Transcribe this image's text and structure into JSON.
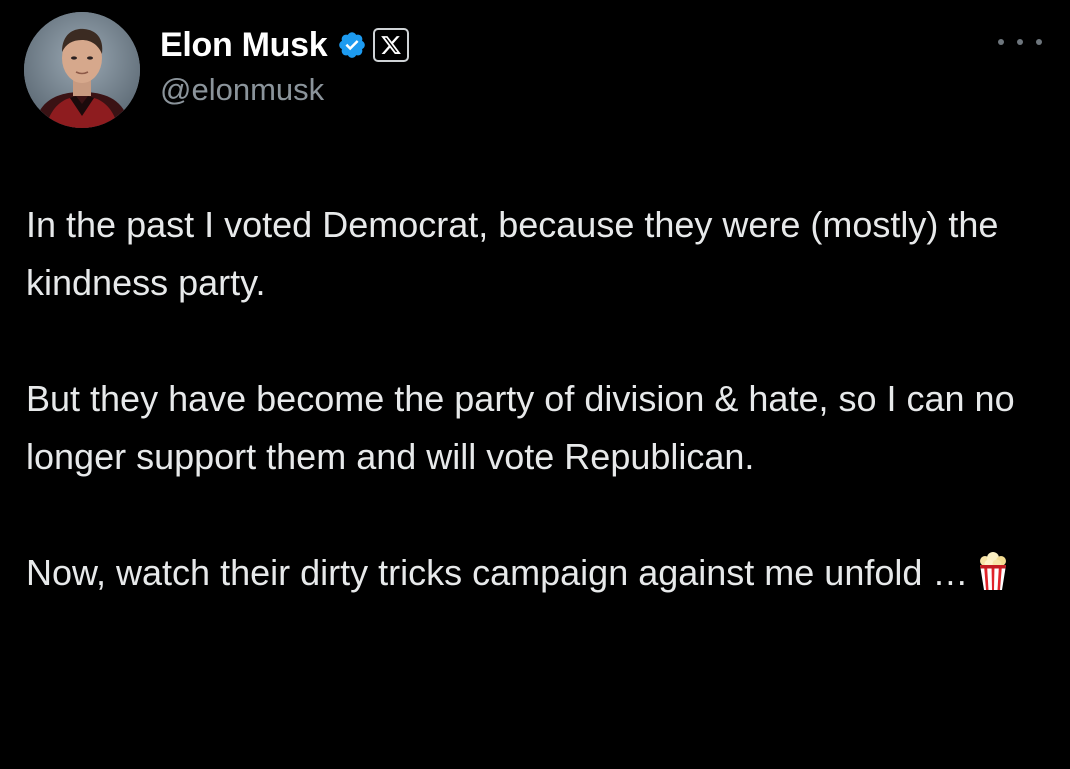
{
  "author": {
    "display_name": "Elon Musk",
    "handle": "@elonmusk",
    "verified": true,
    "badge_color": "#1d9bf0",
    "affiliate_icon": "x-logo-icon",
    "avatar_icon": "profile-photo"
  },
  "menu": {
    "icon": "more-options-icon"
  },
  "tweet": {
    "paragraphs": [
      "In the past I voted Democrat, because they were (mostly) the kindness party.",
      "But they have become the party of division & hate, so I can no longer support them and will vote Republican.",
      "Now, watch their dirty tricks campaign against me unfold …"
    ],
    "trailing_emoji": "popcorn-icon"
  },
  "colors": {
    "background": "#000000",
    "text": "#e7e9ea",
    "secondary_text": "#8b949b",
    "accent": "#1d9bf0"
  }
}
